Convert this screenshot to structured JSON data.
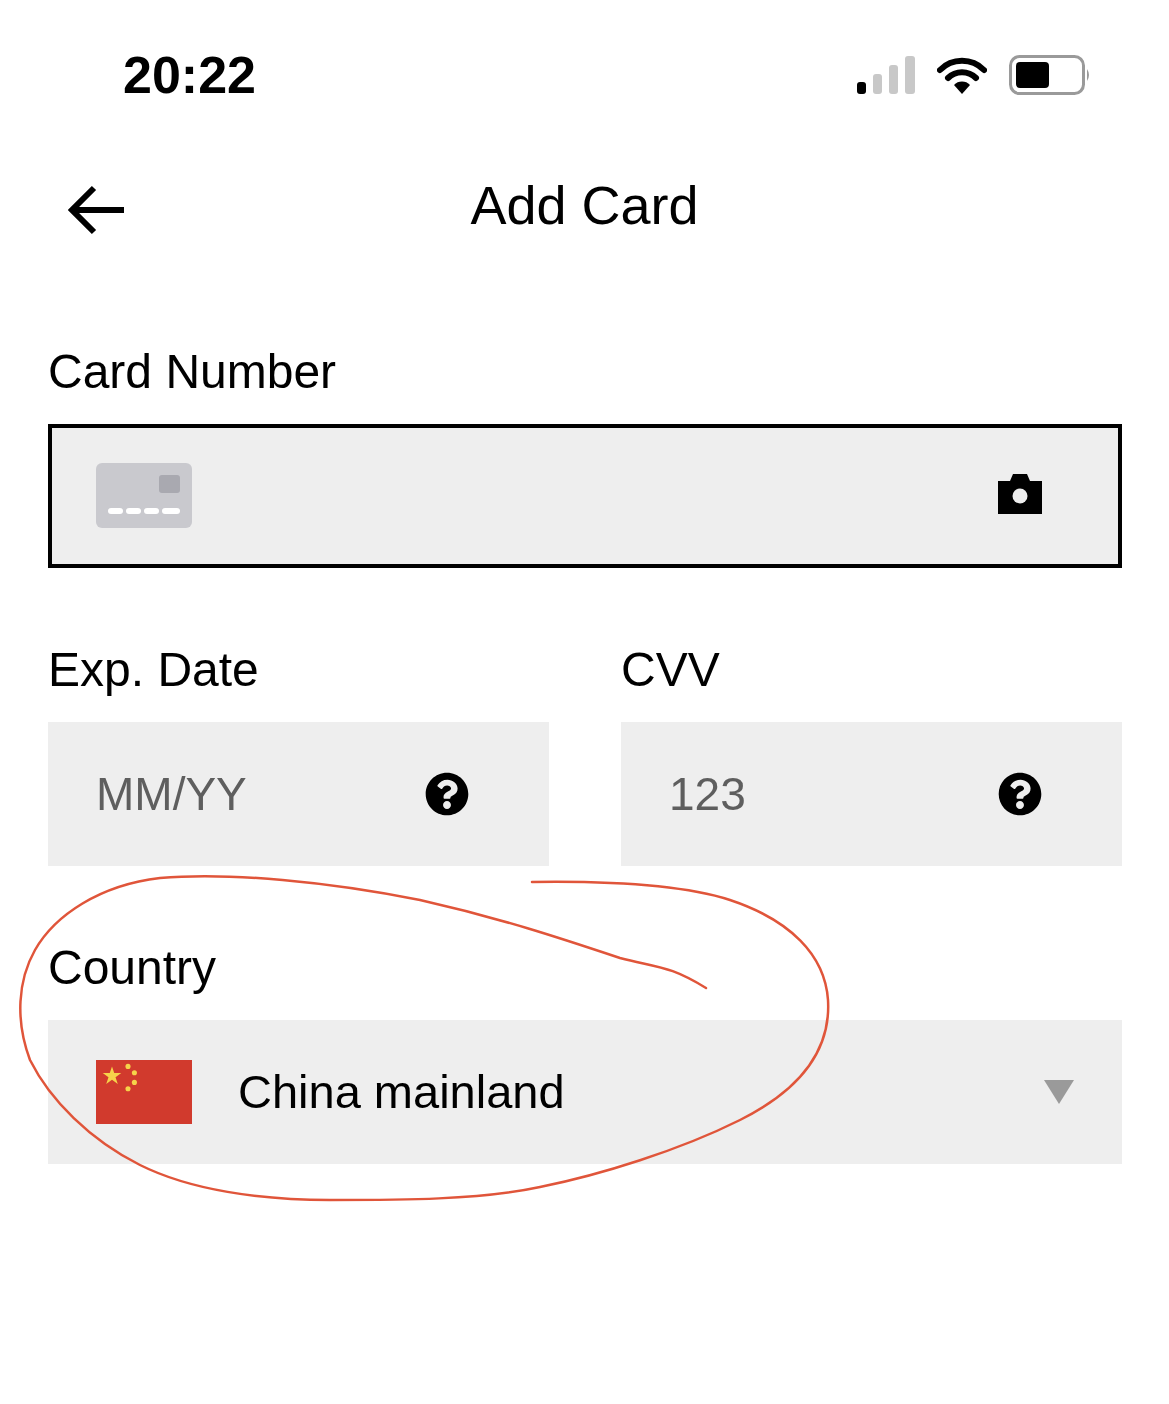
{
  "status_bar": {
    "time": "20:22"
  },
  "header": {
    "title": "Add Card"
  },
  "card_number": {
    "label": "Card Number",
    "focused": true
  },
  "expiry_date": {
    "label": "Exp. Date",
    "placeholder": "MM/YY"
  },
  "cvv": {
    "label": "CVV",
    "placeholder": "123"
  },
  "country": {
    "label": "Country",
    "value": "China mainland"
  }
}
